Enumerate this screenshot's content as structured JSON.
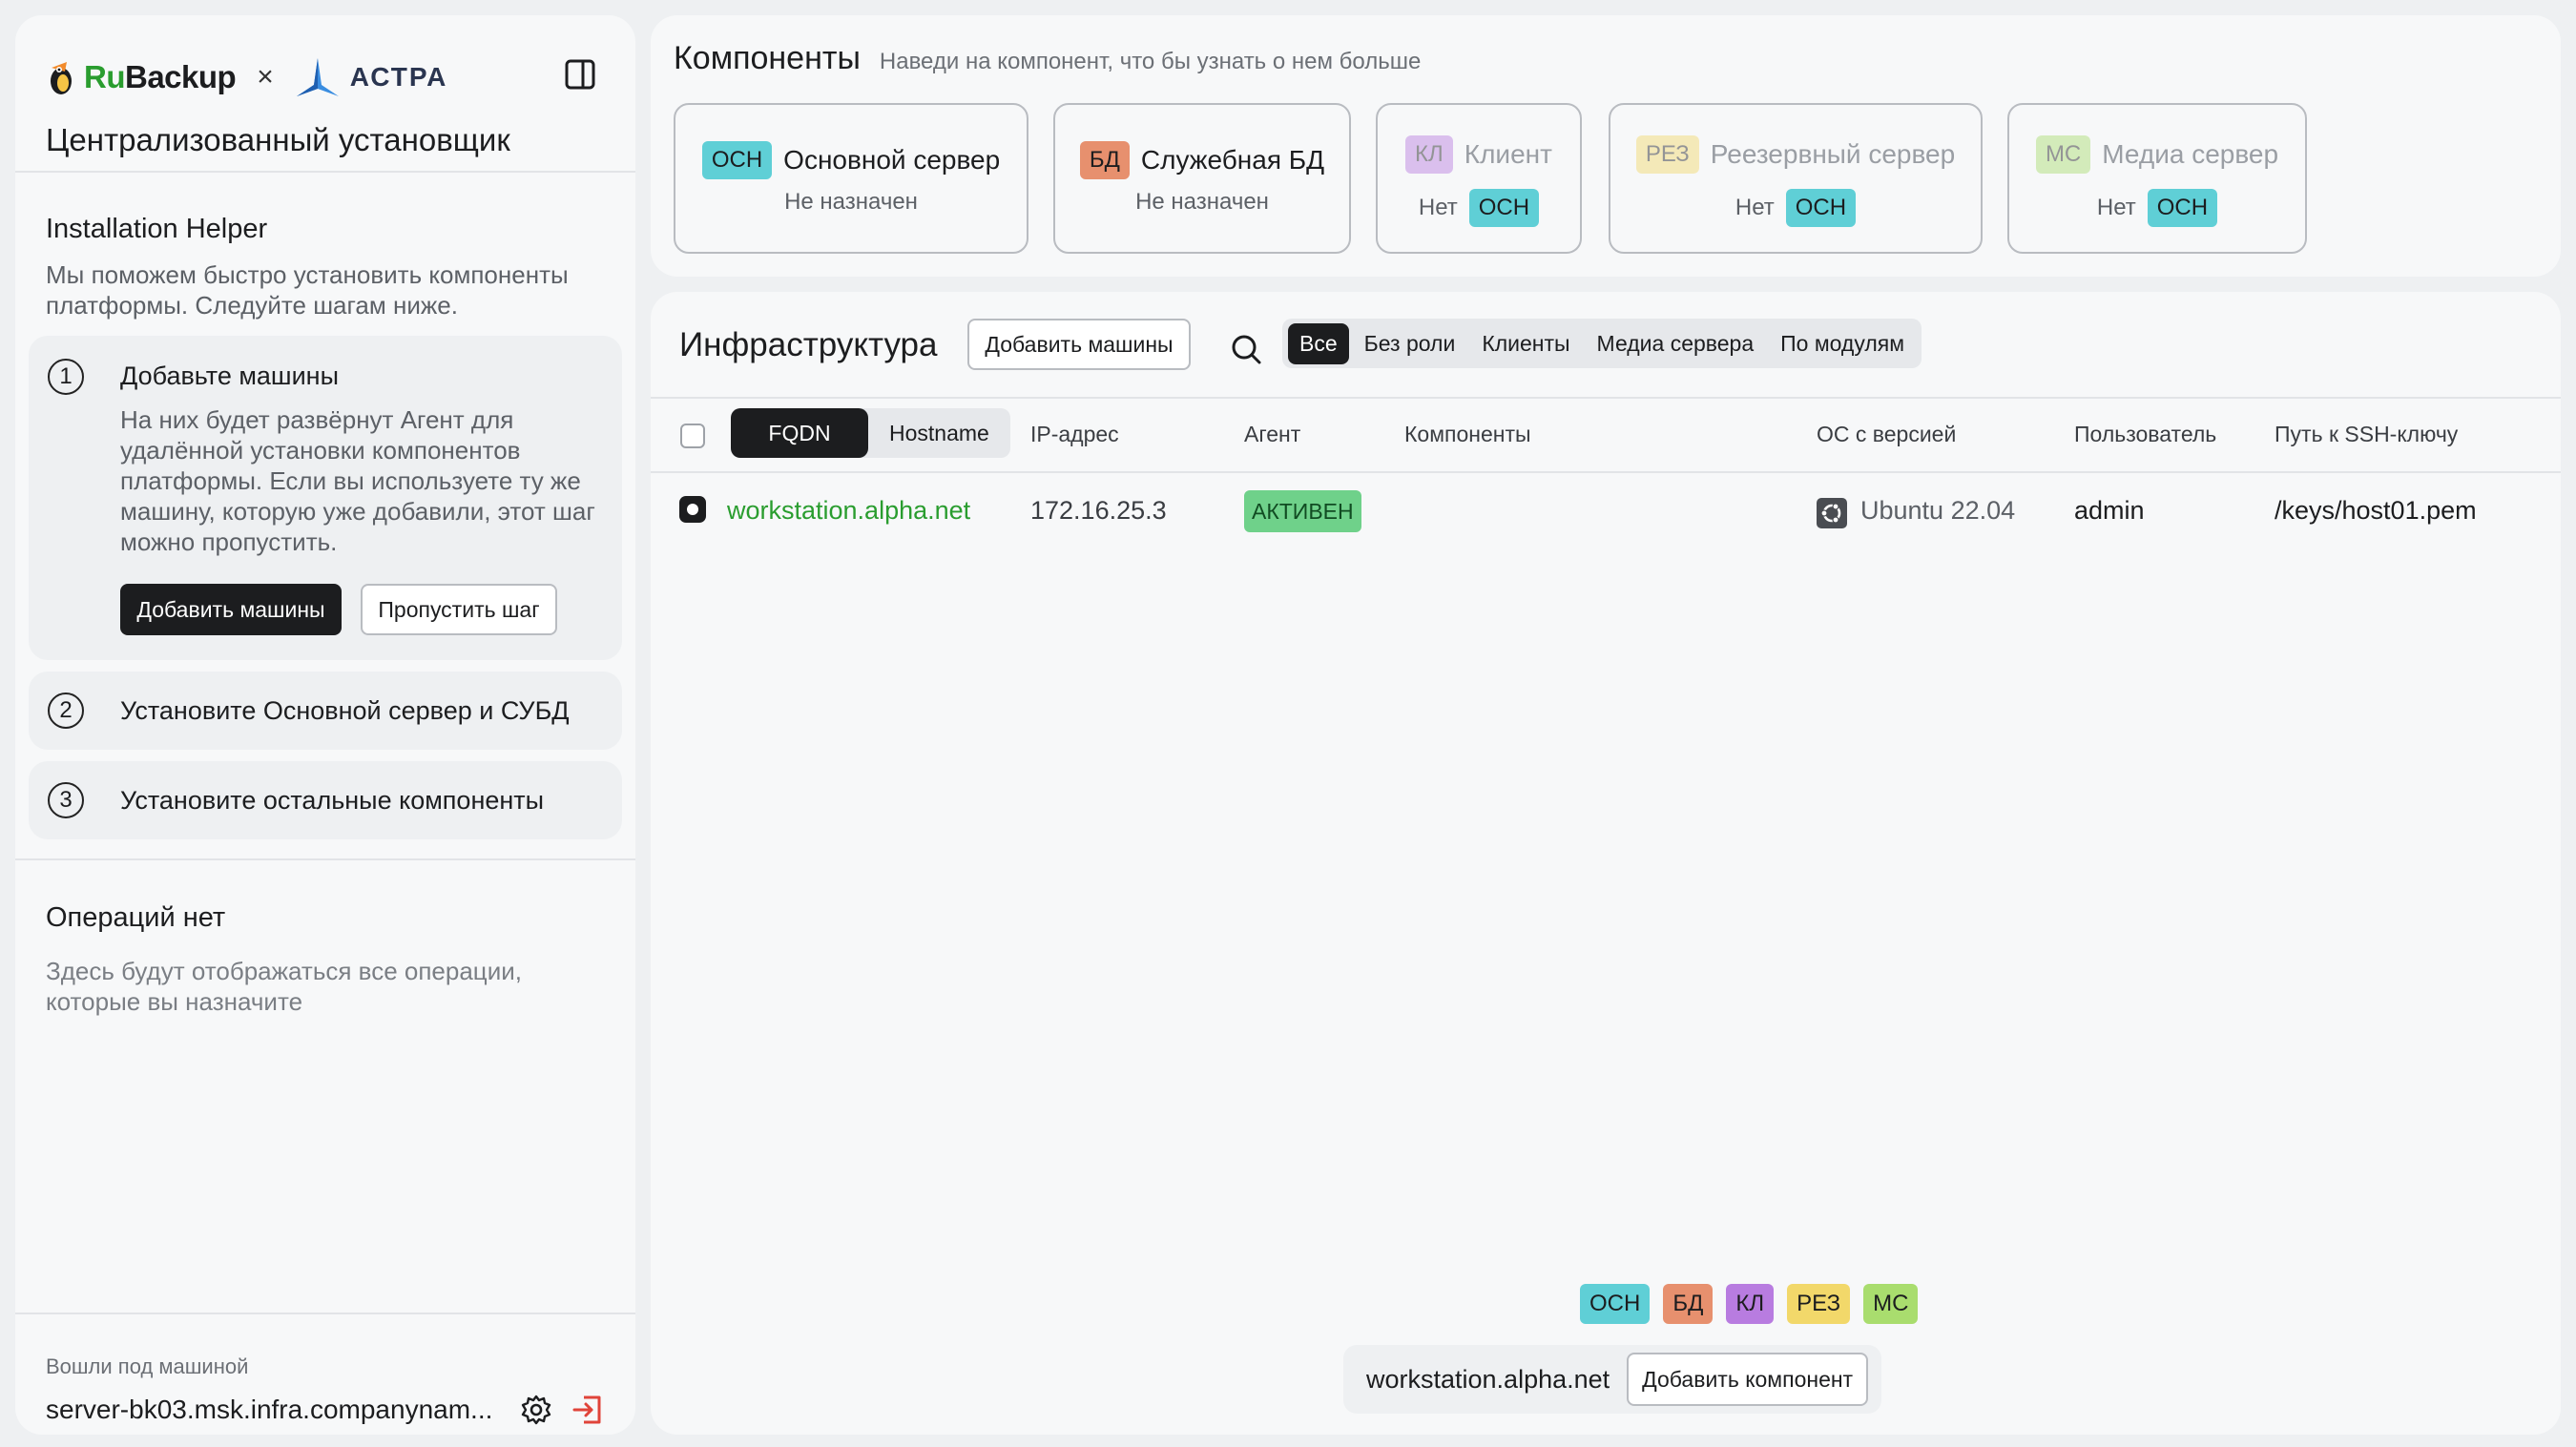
{
  "sidebar": {
    "brand": {
      "rubackup_ru": "Ru",
      "rubackup_rest": "Backup",
      "times": "×",
      "astra": "АСТРА"
    },
    "title": "Централизованный установщик",
    "helper": {
      "title": "Installation Helper",
      "description": "Мы поможем быстро установить компоненты платформы. Следуйте шагам ниже."
    },
    "steps": [
      {
        "number": "1",
        "title": "Добавьте машины",
        "body": "На них будет развёрнут Агент для удалённой установки компонентов платформы. Если вы используете ту же машину, которую уже добавили, этот шаг можно пропустить.",
        "primary_label": "Добавить машины",
        "secondary_label": "Пропустить шаг"
      },
      {
        "number": "2",
        "title": "Установите Основной сервер и СУБД"
      },
      {
        "number": "3",
        "title": "Установите остальные компоненты"
      }
    ],
    "operations": {
      "title": "Операций нет",
      "description": "Здесь будут отображаться все операции, которые вы назначите"
    },
    "login": {
      "label": "Вошли под машиной",
      "host": "server-bk03.msk.infra.companynam..."
    }
  },
  "components": {
    "title": "Компоненты",
    "subtitle": "Наведи на компонент, что бы узнать о нем больше",
    "cards": [
      {
        "badge": "ОСН",
        "name": "Основной сервер",
        "status": "Не назначен"
      },
      {
        "badge": "БД",
        "name": "Служебная БД",
        "status": "Не назначен"
      },
      {
        "badge": "КЛ",
        "name": "Клиент",
        "status": "Нет",
        "dependency": "ОСН"
      },
      {
        "badge": "РЕЗ",
        "name": "Реезервный сервер",
        "status": "Нет",
        "dependency": "ОСН"
      },
      {
        "badge": "МС",
        "name": "Медиа сервер",
        "status": "Нет",
        "dependency": "ОСН"
      }
    ]
  },
  "infrastructure": {
    "title": "Инфраструктура",
    "add_button": "Добавить машины",
    "filters": [
      "Все",
      "Без роли",
      "Клиенты",
      "Медиа сервера",
      "По модулям"
    ],
    "active_filter": "Все",
    "name_toggle": {
      "fqdn": "FQDN",
      "hostname": "Hostname",
      "active": "FQDN"
    },
    "columns": {
      "ip": "IP-адрес",
      "agent": "Агент",
      "components": "Компоненты",
      "os": "ОС с версией",
      "user": "Пользователь",
      "ssh": "Путь к SSH-ключу"
    },
    "rows": [
      {
        "fqdn": "workstation.alpha.net",
        "ip": "172.16.25.3",
        "agent": "АКТИВЕН",
        "components": "",
        "os": "Ubuntu 22.04",
        "user": "admin",
        "ssh": "/keys/host01.pem"
      }
    ],
    "selection_bar": {
      "badges": [
        "ОСН",
        "БД",
        "КЛ",
        "РЕЗ",
        "МС"
      ],
      "host": "workstation.alpha.net",
      "action": "Добавить компонент"
    }
  },
  "colors": {
    "osn": "#5fcfd6",
    "bd": "#e7906e",
    "kl": "#b87ce0",
    "rez": "#f2d86a",
    "ms": "#a9dd6e",
    "link": "#2a9d2f",
    "agent_active": "#6fd18a"
  }
}
